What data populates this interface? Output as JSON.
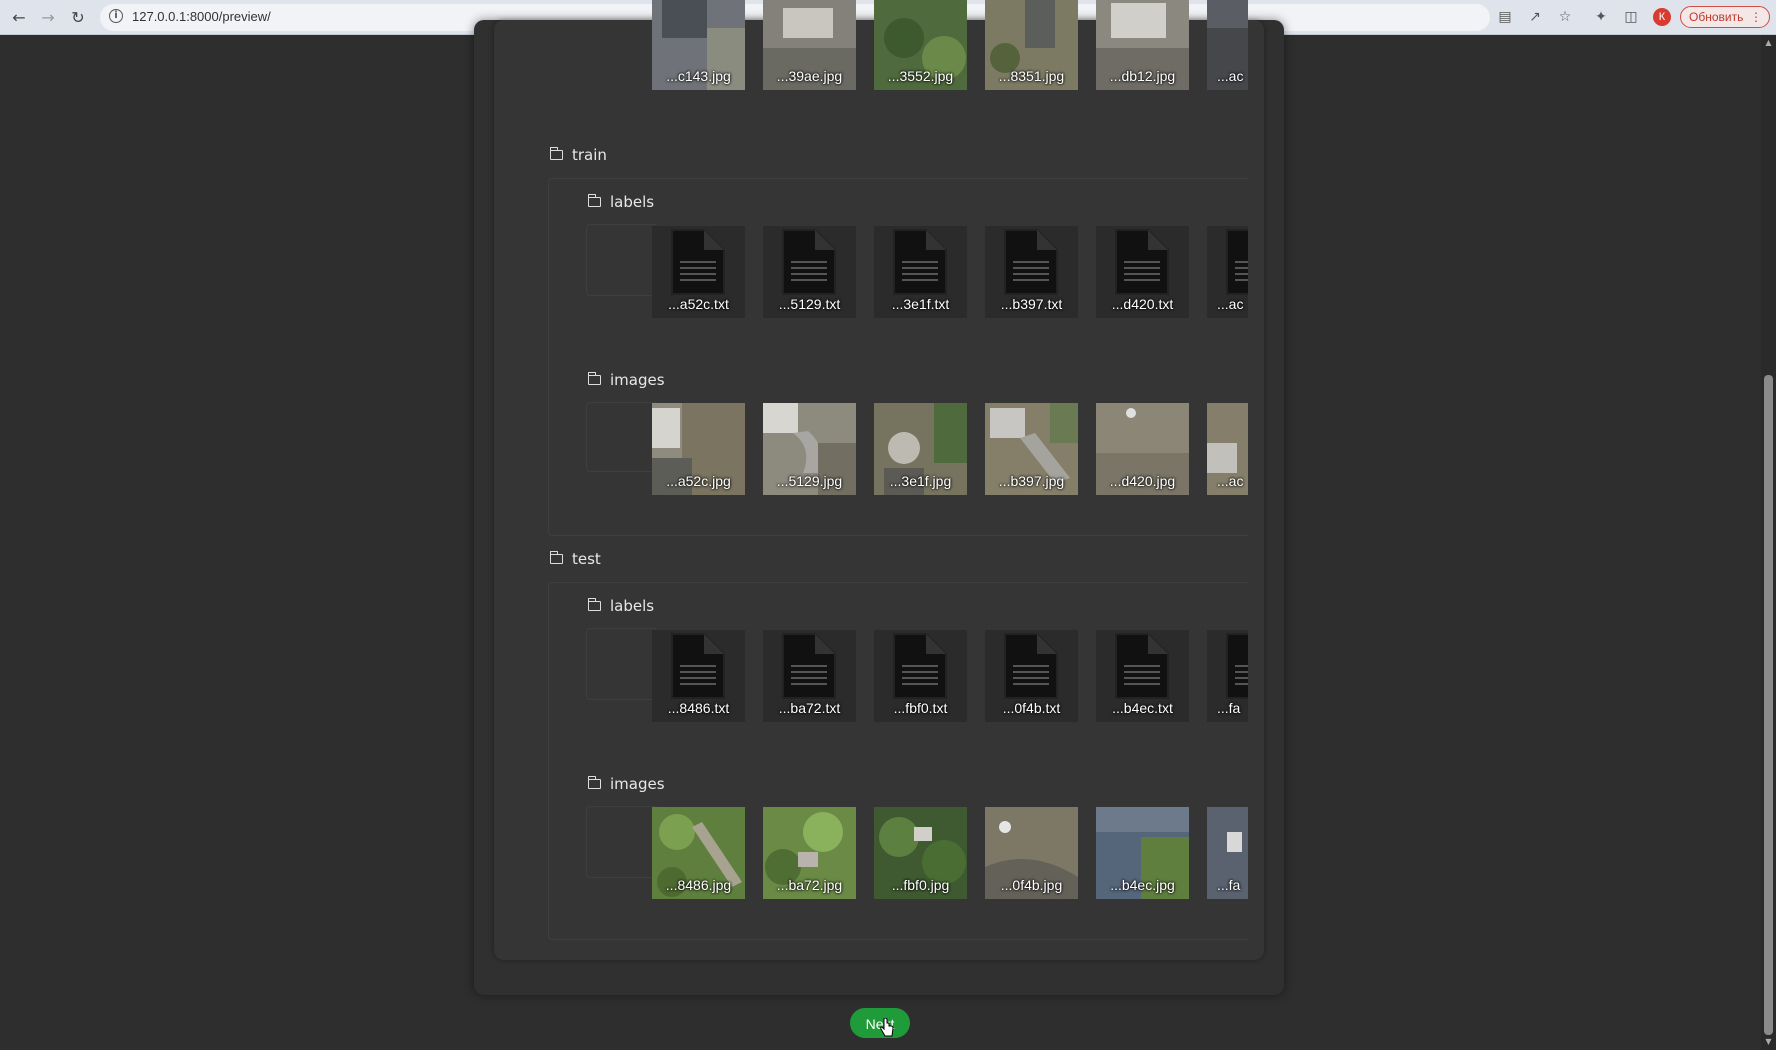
{
  "browser": {
    "url": "127.0.0.1:8000/preview/",
    "profile_initial": "К",
    "update_label": "Обновить"
  },
  "colors": {
    "page_bg": "#2e2e2e",
    "panel_bg": "#303030",
    "inner_bg": "#353535",
    "next_btn": "#1f9b3a"
  },
  "top_strip": {
    "items": [
      "...c143.jpg",
      "...39ae.jpg",
      "...3552.jpg",
      "...8351.jpg",
      "...db12.jpg",
      "...ac"
    ]
  },
  "folders": {
    "train": {
      "label": "train",
      "labels": {
        "label": "labels",
        "items": [
          "...a52c.txt",
          "...5129.txt",
          "...3e1f.txt",
          "...b397.txt",
          "...d420.txt",
          "...ac"
        ]
      },
      "images": {
        "label": "images",
        "items": [
          "...a52c.jpg",
          "...5129.jpg",
          "...3e1f.jpg",
          "...b397.jpg",
          "...d420.jpg",
          "...ac"
        ]
      }
    },
    "test": {
      "label": "test",
      "labels": {
        "label": "labels",
        "items": [
          "...8486.txt",
          "...ba72.txt",
          "...fbf0.txt",
          "...0f4b.txt",
          "...b4ec.txt",
          "...fa"
        ]
      },
      "images": {
        "label": "images",
        "items": [
          "...8486.jpg",
          "...ba72.jpg",
          "...fbf0.jpg",
          "...0f4b.jpg",
          "...b4ec.jpg",
          "...fa"
        ]
      }
    }
  },
  "next_label": "Next"
}
